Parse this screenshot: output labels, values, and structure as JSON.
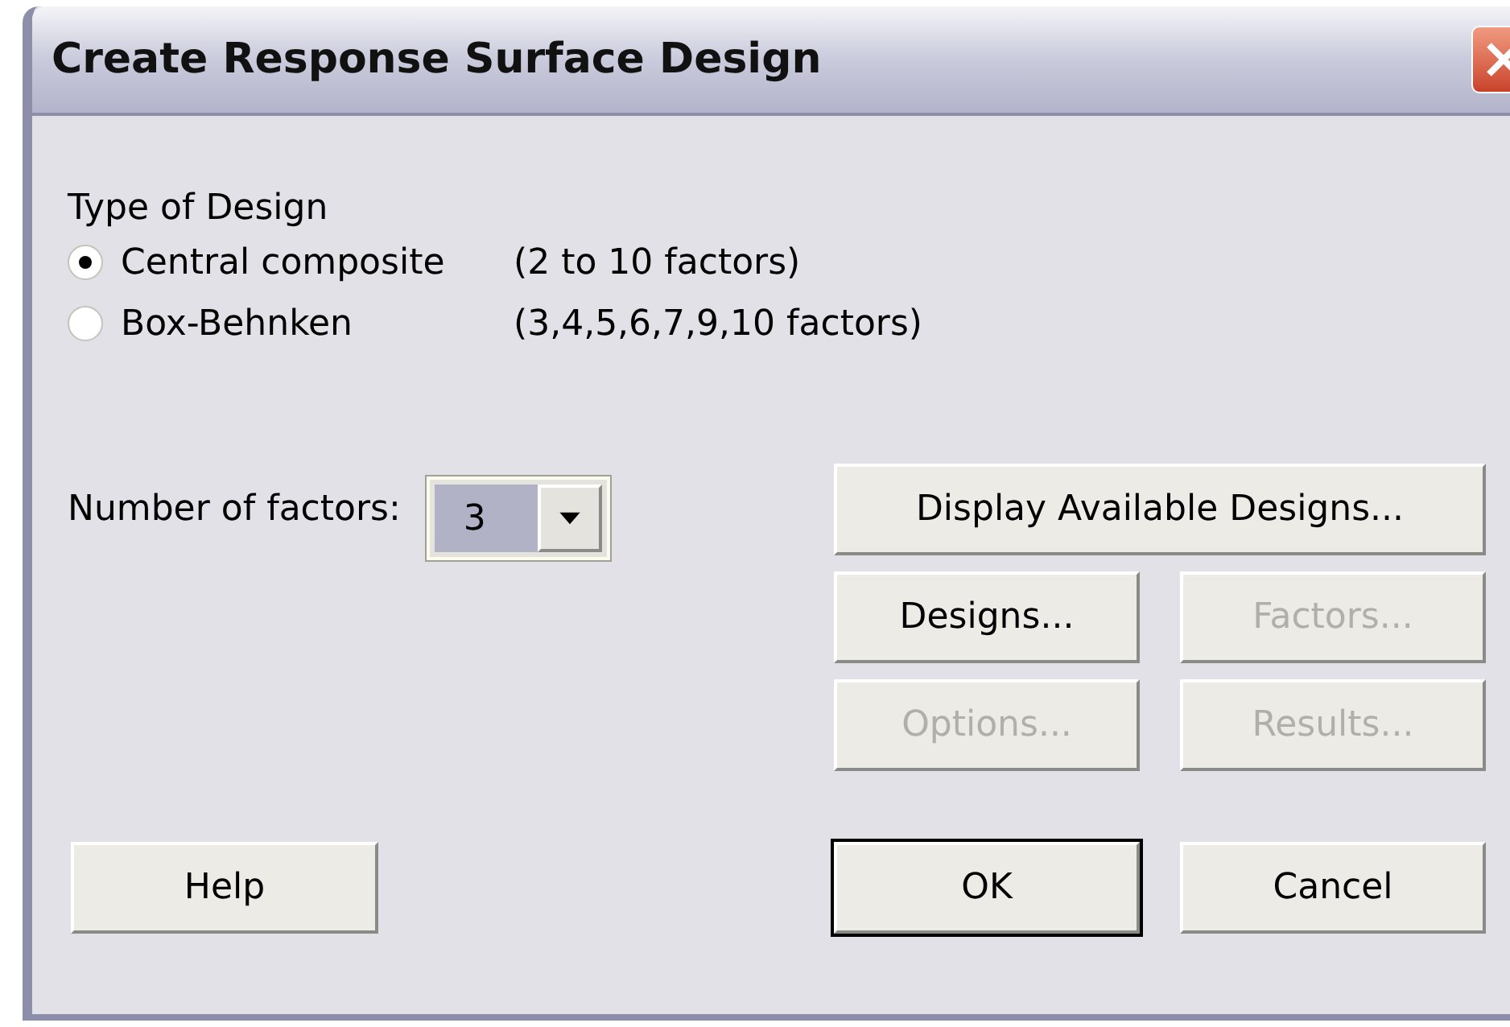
{
  "window": {
    "title": "Create Response Surface Design"
  },
  "design_type": {
    "label": "Type of Design",
    "options": [
      {
        "label": "Central composite",
        "range": "(2 to 10 factors)",
        "selected": true
      },
      {
        "label": "Box-Behnken",
        "range": "(3,4,5,6,7,9,10 factors)",
        "selected": false
      }
    ]
  },
  "number_of_factors": {
    "label": "Number of factors:",
    "value": "3"
  },
  "buttons": [
    {
      "label": "Display Available Designs...",
      "disabled": false
    },
    {
      "label": "Designs...",
      "disabled": false
    },
    {
      "label": "Factors...",
      "disabled": true
    },
    {
      "label": "Options...",
      "disabled": true
    },
    {
      "label": "Results...",
      "disabled": true
    }
  ],
  "footer_buttons": [
    {
      "label": "Help",
      "default": false
    },
    {
      "label": "OK",
      "default": true
    },
    {
      "label": "Cancel",
      "default": false
    }
  ]
}
